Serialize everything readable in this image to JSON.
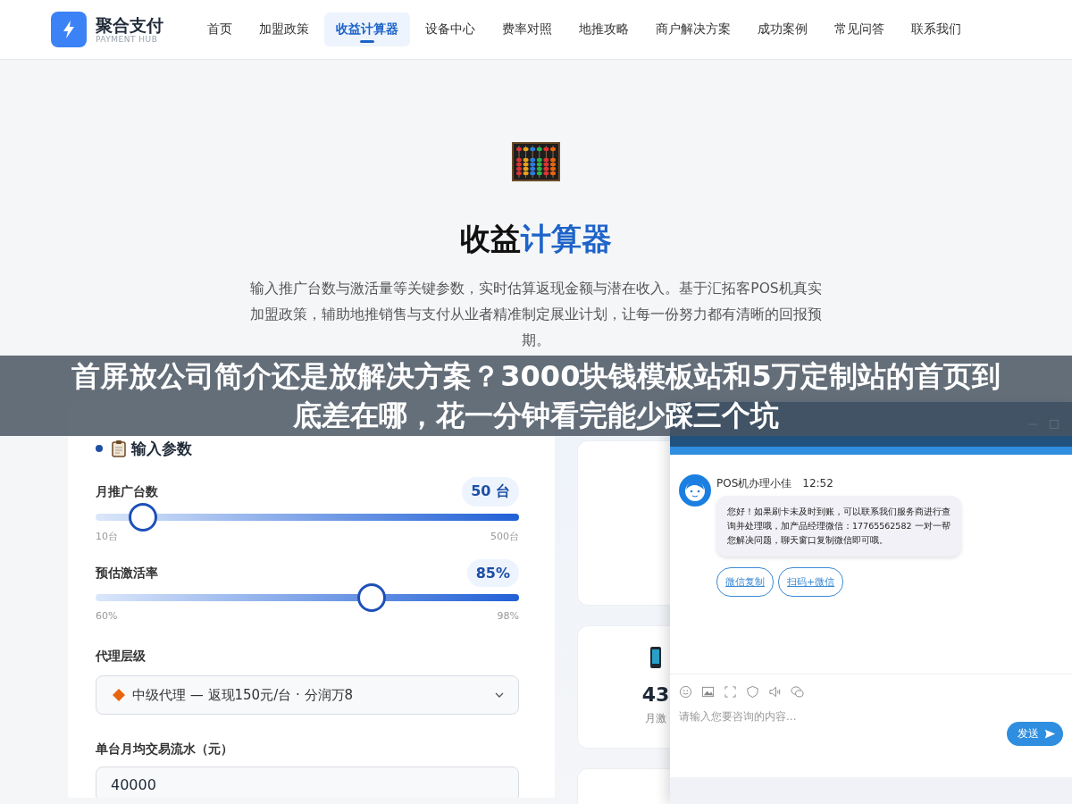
{
  "brand": {
    "name": "聚合支付",
    "tagline": "PAYMENT HUB"
  },
  "nav": [
    {
      "label": "首页",
      "selected": false
    },
    {
      "label": "加盟政策",
      "selected": false
    },
    {
      "label": "收益计算器",
      "selected": true
    },
    {
      "label": "设备中心",
      "selected": false
    },
    {
      "label": "费率对照",
      "selected": false
    },
    {
      "label": "地推攻略",
      "selected": false
    },
    {
      "label": "商户解决方案",
      "selected": false
    },
    {
      "label": "成功案例",
      "selected": false
    },
    {
      "label": "常见问答",
      "selected": false
    },
    {
      "label": "联系我们",
      "selected": false
    }
  ],
  "hero": {
    "title_plain": "收益",
    "title_accent": "计算器",
    "description": "输入推广台数与激活量等关键参数，实时估算返现金额与潜在收入。基于汇拓客POS机真实加盟政策，辅助地推销售与支付从业者精准制定展业计划，让每一份努力都有清晰的回报预期。"
  },
  "input_panel": {
    "title": "输入参数",
    "sliders": [
      {
        "label": "月推广台数",
        "value": "50 台",
        "level": 0.11,
        "min": "10台",
        "max": "500台"
      },
      {
        "label": "预估激活率",
        "value": "85%",
        "level": 0.65,
        "min": "60%",
        "max": "98%"
      }
    ],
    "tier": {
      "label": "代理层级",
      "value": "中级代理 — 返现150元/台 · 分润万8"
    },
    "volume": {
      "label": "单台月均交易流水（元）",
      "value": "40000"
    }
  },
  "result_cards": [
    {
      "kind": "empty"
    },
    {
      "kind": "stat",
      "value": "43",
      "caption": "月激"
    },
    {
      "kind": "stub"
    }
  ],
  "overlay_banner": {
    "text": "首屏放公司简介还是放解决方案？3000块钱模板站和5万定制站的首页到底差在哪，花一分钟看完能少踩三个坑"
  },
  "chat": {
    "message": {
      "sender": "POS机办理小佳",
      "time": "12:52",
      "text": "您好！如果刷卡未及时到账，可以联系我们服务商进行查询并处理哦，加产品经理微信：17765562582 一对一帮您解决问题，聊天窗口复制微信即可哦。"
    },
    "links": [
      "微信复制",
      "扫码+微信"
    ],
    "placeholder": "请输入您要咨询的内容...",
    "send": "发送"
  }
}
